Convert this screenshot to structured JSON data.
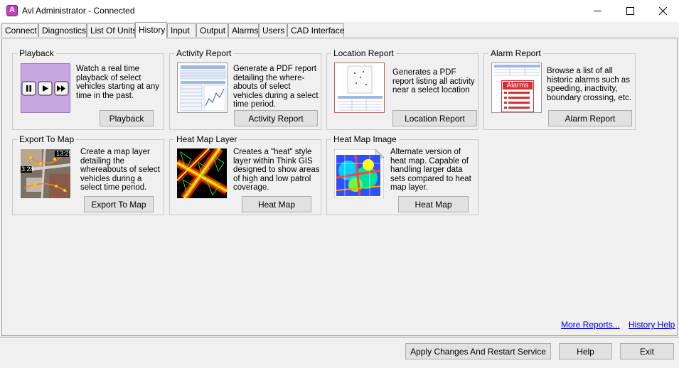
{
  "window": {
    "title": "Avl Administrator - Connected",
    "controls": {
      "minimize": "minimize",
      "maximize": "maximize",
      "close": "close"
    }
  },
  "tabs": [
    {
      "label": "Connect"
    },
    {
      "label": "Diagnostics"
    },
    {
      "label": "List Of Units"
    },
    {
      "label": "History",
      "active": true
    },
    {
      "label": "Input"
    },
    {
      "label": "Output"
    },
    {
      "label": "Alarms"
    },
    {
      "label": "Users"
    },
    {
      "label": "CAD Interface"
    }
  ],
  "panels": {
    "playback": {
      "title": "Playback",
      "description": "Watch a real time playback of select vehicles starting at any time in the past.",
      "button": "Playback"
    },
    "activity_report": {
      "title": "Activity Report",
      "description": "Generate a PDF report detailing the where-abouts of select vehicles during a select time period.",
      "button": "Activity Report"
    },
    "location_report": {
      "title": "Location Report",
      "description": "Generates a PDF report listing all activity near a select location",
      "button": "Location Report"
    },
    "alarm_report": {
      "title": "Alarm Report",
      "description": "Browse a list of all historic alarms such as speeding, inactivity, boundary crossing, etc.",
      "button": "Alarm Report",
      "thumb_label": "Alarms"
    },
    "export_to_map": {
      "title": "Export To Map",
      "description": "Create a map layer detailing the whereabouts of select vehicles during a select time period.",
      "button": "Export To Map",
      "thumb_labels": [
        "13:29",
        "3:28"
      ]
    },
    "heat_map_layer": {
      "title": "Heat Map Layer",
      "description": "Creates a \"heat\" style layer within Think GIS designed to show areas of high and low patrol coverage.",
      "button": "Heat Map"
    },
    "heat_map_image": {
      "title": "Heat Map Image",
      "description": "Alternate version of heat map.  Capable of handling larger data sets compared to heat map layer.",
      "button": "Heat Map"
    }
  },
  "links": {
    "more_reports": "More Reports...",
    "history_help": "History Help"
  },
  "footer": {
    "apply": "Apply Changes And Restart Service",
    "help": "Help",
    "exit": "Exit"
  },
  "colors": {
    "accent_purple": "#c8a8e0",
    "alarm_red": "#d03030",
    "link_blue": "#0000ee"
  }
}
